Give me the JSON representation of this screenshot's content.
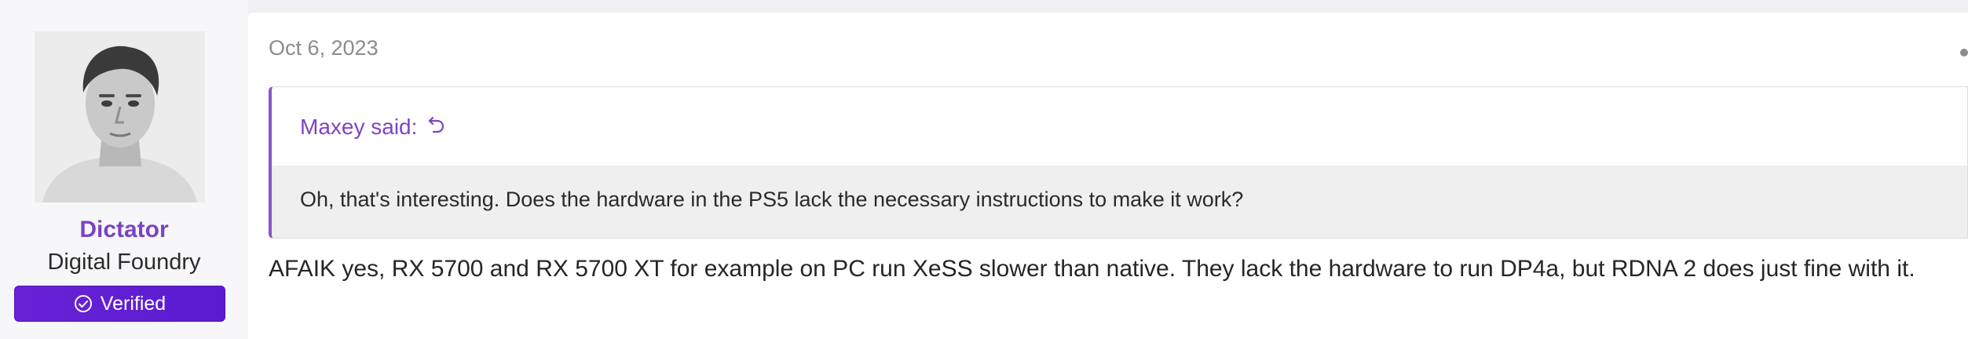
{
  "user": {
    "name": "Dictator",
    "title": "Digital Foundry",
    "badge": "Verified"
  },
  "post": {
    "date": "Oct 6, 2023",
    "quote": {
      "author": "Maxey said:",
      "text": "Oh, that's interesting. Does the hardware in the PS5 lack the necessary instructions to make it work?"
    },
    "message": "AFAIK yes, RX 5700 and RX 5700 XT for example on PC run XeSS slower than native. They lack the hardware to run DP4a, but RDNA 2 does just fine with it."
  },
  "icons": {
    "badge": "check-circle-icon",
    "quote_jump": "undo-arrow-icon",
    "menu": "more-options-icon"
  },
  "colors": {
    "username": "#7a44c2",
    "badge_bg": "#6a22d6",
    "quote_accent": "#8a53cf"
  }
}
